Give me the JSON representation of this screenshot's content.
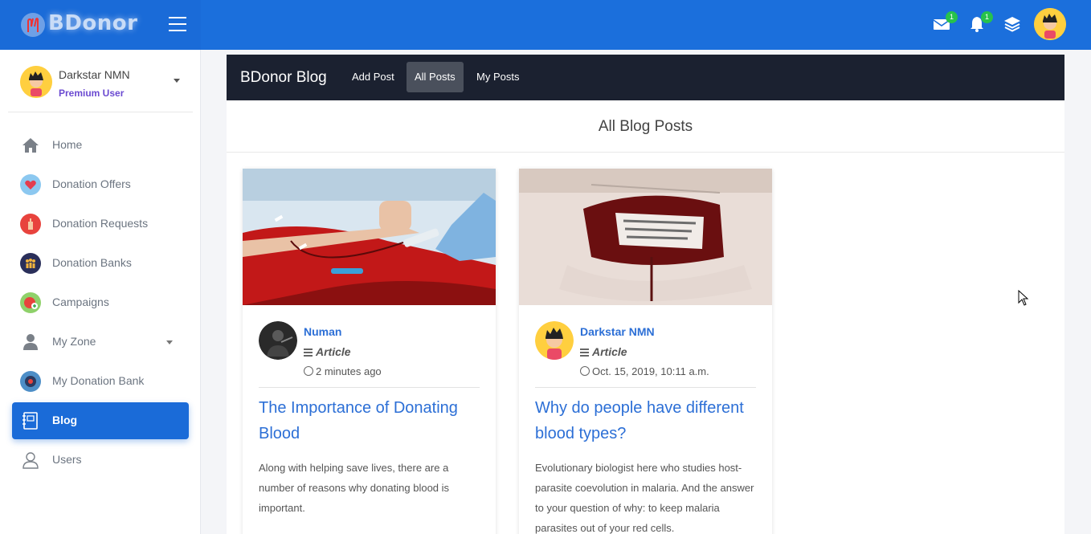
{
  "app": {
    "logo_text": "BDonor"
  },
  "topbar": {
    "mail_badge": "1",
    "notification_badge": "1"
  },
  "sidebar": {
    "user": {
      "name": "Darkstar NMN",
      "role": "Premium User"
    },
    "items": [
      {
        "label": "Home",
        "icon": "home-icon",
        "active": false
      },
      {
        "label": "Donation Offers",
        "icon": "heart-hand-icon",
        "active": false
      },
      {
        "label": "Donation Requests",
        "icon": "hand-request-icon",
        "active": false
      },
      {
        "label": "Donation Banks",
        "icon": "people-bank-icon",
        "active": false
      },
      {
        "label": "Campaigns",
        "icon": "campaign-icon",
        "active": false
      },
      {
        "label": "My Zone",
        "icon": "person-icon",
        "active": false
      },
      {
        "label": "My Donation Bank",
        "icon": "donation-bank-icon",
        "active": false
      },
      {
        "label": "Blog",
        "icon": "notebook-icon",
        "active": true
      },
      {
        "label": "Users",
        "icon": "users-icon",
        "active": false
      }
    ]
  },
  "blog_nav": {
    "title": "BDonor Blog",
    "tabs": [
      {
        "label": "Add Post",
        "active": false
      },
      {
        "label": "All Posts",
        "active": true
      },
      {
        "label": "My Posts",
        "active": false
      }
    ]
  },
  "main": {
    "section_title": "All Blog Posts",
    "posts": [
      {
        "author": "Numan",
        "type": "Article",
        "time": "2 minutes ago",
        "title": "The Importance of Donating Blood",
        "excerpt": "Along with helping save lives, there are a number of reasons why donating blood is important."
      },
      {
        "author": "Darkstar NMN",
        "type": "Article",
        "time": "Oct. 15, 2019, 10:11 a.m.",
        "title": "Why do people have different blood types?",
        "excerpt": "Evolutionary biologist here who studies host-parasite coevolution in malaria. And the answer to your question of why: to keep malaria parasites out of your red cells."
      }
    ]
  },
  "colors": {
    "primary": "#1a6bd8",
    "dark_nav": "#1b2130",
    "link": "#2c6fd6",
    "premium": "#6b4ad1",
    "badge": "#27c24c"
  }
}
